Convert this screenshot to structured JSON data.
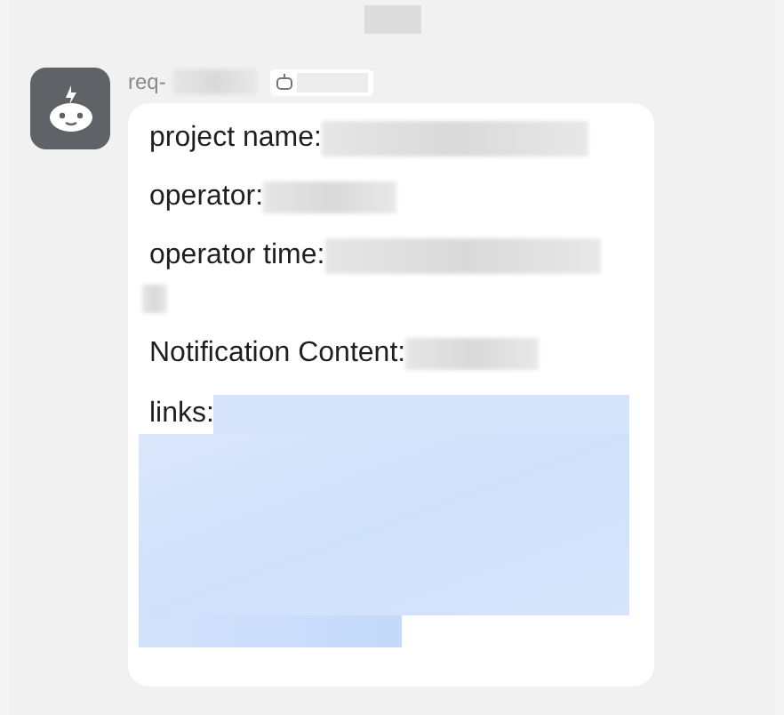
{
  "sender": {
    "name": "req-"
  },
  "message": {
    "fields": [
      {
        "label": "project name:",
        "kind": "text"
      },
      {
        "label": "operator:",
        "kind": "short"
      },
      {
        "label": "operator time:",
        "kind": "wrapped"
      },
      {
        "label": "Notification Content:",
        "kind": "short"
      },
      {
        "label": "links:",
        "kind": "link"
      }
    ]
  }
}
